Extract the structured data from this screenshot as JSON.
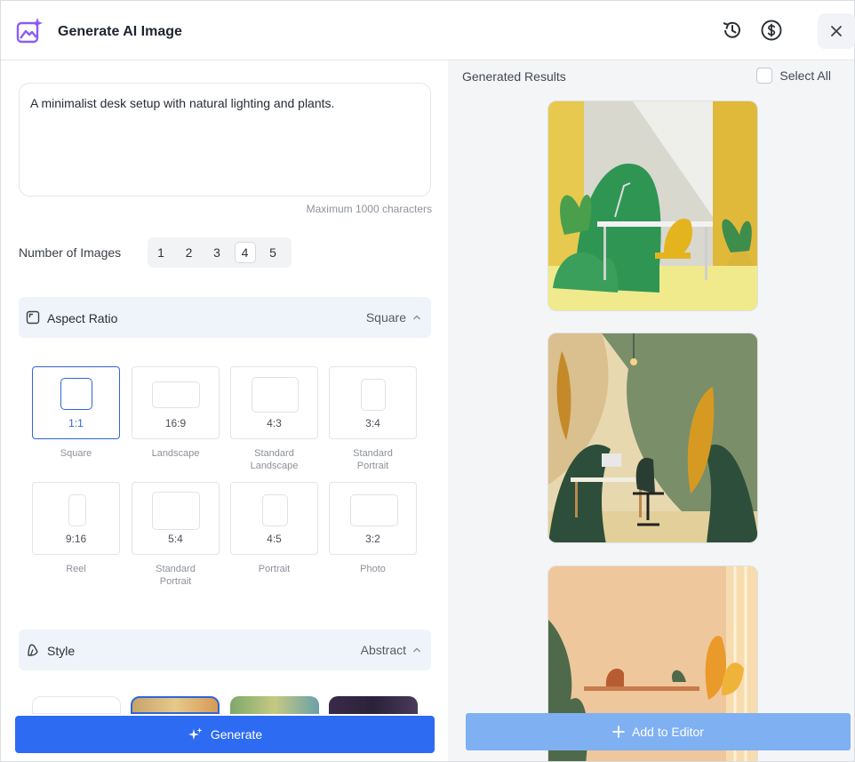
{
  "header": {
    "title": "Generate AI Image",
    "icons": [
      "ai-image-logo-icon",
      "history-icon",
      "dollar-icon",
      "close-icon"
    ],
    "brand_color": "#8b5cf6"
  },
  "prompt": {
    "value": "A minimalist desk setup with natural lighting and plants.",
    "hint": "Maximum 1000 characters"
  },
  "num_images": {
    "label": "Number of Images",
    "options": [
      "1",
      "2",
      "3",
      "4",
      "5"
    ],
    "selected": "4"
  },
  "aspect_ratio": {
    "label": "Aspect Ratio",
    "value": "Square",
    "options": [
      {
        "ratio": "1:1",
        "name": "Square",
        "selected": true
      },
      {
        "ratio": "16:9",
        "name": "Landscape"
      },
      {
        "ratio": "4:3",
        "name": "Standard Landscape"
      },
      {
        "ratio": "3:4",
        "name": "Standard Portrait"
      },
      {
        "ratio": "9:16",
        "name": "Reel"
      },
      {
        "ratio": "5:4",
        "name": "Standard Portrait"
      },
      {
        "ratio": "4:5",
        "name": "Portrait"
      },
      {
        "ratio": "3:2",
        "name": "Photo"
      }
    ]
  },
  "style": {
    "label": "Style",
    "value": "Abstract"
  },
  "generate": {
    "label": "Generate",
    "color": "#2d6bf3"
  },
  "results": {
    "label": "Generated Results",
    "select_all": "Select All",
    "images": [
      "desk-scene-yellow",
      "desk-scene-jungle",
      "desk-scene-sunlit"
    ]
  },
  "add_to_editor": {
    "label": "Add to Editor",
    "color": "#7fb0f2"
  }
}
